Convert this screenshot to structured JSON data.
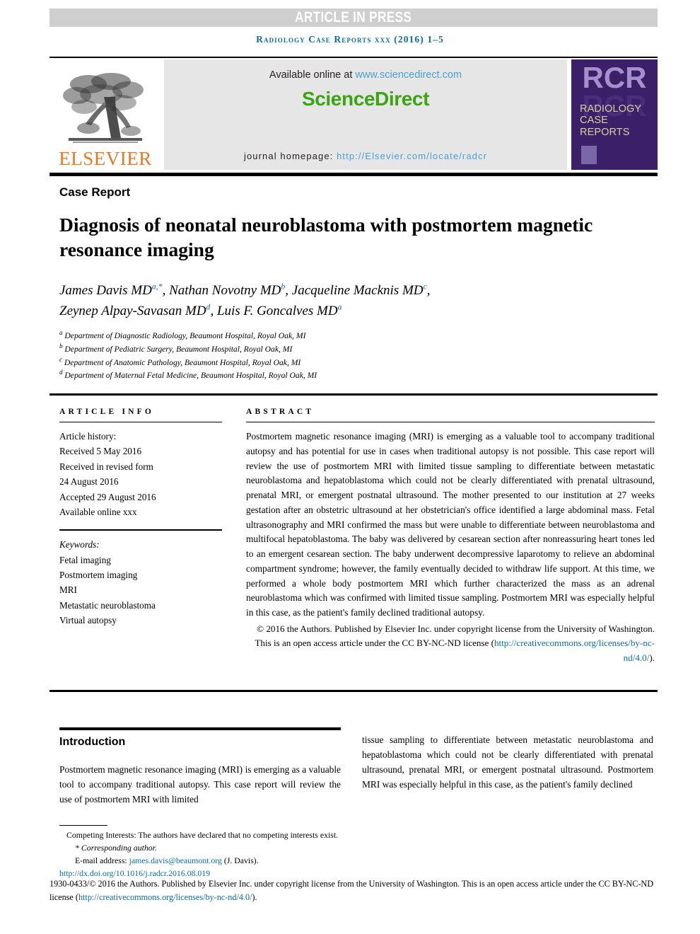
{
  "banner": {
    "label": "ARTICLE IN PRESS"
  },
  "journal_citation": {
    "text": "Radiology Case Reports xxx (2016) 1–5"
  },
  "masthead": {
    "publisher_logo_name": "elsevier-tree-logo",
    "publisher_wordmark": "ELSEVIER",
    "available_prefix": "Available online at ",
    "available_link": "www.sciencedirect.com",
    "sciencedirect_logo": "ScienceDirect",
    "homepage_prefix": "journal homepage: ",
    "homepage_link": "http://Elsevier.com/locate/radcr",
    "cover": {
      "initials": "RCR",
      "line1": "RADIOLOGY",
      "line2": "CASE",
      "line3": "REPORTS"
    }
  },
  "article": {
    "type": "Case Report",
    "title": "Diagnosis of neonatal neuroblastoma with postmortem magnetic resonance imaging",
    "authors": [
      {
        "name": "James Davis MD",
        "marks": "a,*"
      },
      {
        "name": "Nathan Novotny MD",
        "marks": "b"
      },
      {
        "name": "Jacqueline Macknis MD",
        "marks": "c"
      },
      {
        "name": "Zeynep Alpay-Savasan MD",
        "marks": "d"
      },
      {
        "name": "Luis F. Goncalves MD",
        "marks": "a"
      }
    ],
    "affiliations": [
      {
        "mark": "a",
        "text": "Department of Diagnostic Radiology, Beaumont Hospital, Royal Oak, MI"
      },
      {
        "mark": "b",
        "text": "Department of Pediatric Surgery, Beaumont Hospital, Royal Oak, MI"
      },
      {
        "mark": "c",
        "text": "Department of Anatomic Pathology, Beaumont Hospital, Royal Oak, MI"
      },
      {
        "mark": "d",
        "text": "Department of Maternal Fetal Medicine, Beaumont Hospital, Royal Oak, MI"
      }
    ]
  },
  "article_info": {
    "heading": "ARTICLE INFO",
    "history_label": "Article history:",
    "history": [
      "Received 5 May 2016",
      "Received in revised form",
      "24 August 2016",
      "Accepted 29 August 2016",
      "Available online xxx"
    ],
    "keywords_label": "Keywords:",
    "keywords": [
      "Fetal imaging",
      "Postmortem imaging",
      "MRI",
      "Metastatic neuroblastoma",
      "Virtual autopsy"
    ]
  },
  "abstract": {
    "heading": "ABSTRACT",
    "body": "Postmortem magnetic resonance imaging (MRI) is emerging as a valuable tool to accompany traditional autopsy and has potential for use in cases when traditional autopsy is not possible. This case report will review the use of postmortem MRI with limited tissue sampling to differentiate between metastatic neuroblastoma and hepatoblastoma which could not be clearly differentiated with prenatal ultrasound, prenatal MRI, or emergent postnatal ultrasound. The mother presented to our institution at 27 weeks gestation after an obstetric ultrasound at her obstetrician's office identified a large abdominal mass. Fetal ultrasonography and MRI confirmed the mass but were unable to differentiate between neuroblastoma and multifocal hepatoblastoma. The baby was delivered by cesarean section after nonreassuring heart tones led to an emergent cesarean section. The baby underwent decompressive laparotomy to relieve an abdominal compartment syndrome; however, the family eventually decided to withdraw life support. At this time, we performed a whole body postmortem MRI which further characterized the mass as an adrenal neuroblastoma which was confirmed with limited tissue sampling. Postmortem MRI was especially helpful in this case, as the patient's family declined traditional autopsy.",
    "copyright_lead": "© 2016 the Authors. Published by Elsevier Inc. under copyright license from the University of Washington. This is an open access article under the CC BY-NC-ND license (",
    "copyright_link": "http://creativecommons.org/licenses/by-nc-nd/4.0/",
    "copyright_tail": ")."
  },
  "body": {
    "intro_heading": "Introduction",
    "left_paragraph": "Postmortem magnetic resonance imaging (MRI) is emerging as a valuable tool to accompany traditional autopsy. This case report will review the use of postmortem MRI with limited",
    "right_paragraph": "tissue sampling to differentiate between metastatic neuroblastoma and hepatoblastoma which could not be clearly differentiated with prenatal ultrasound, prenatal MRI, or emergent postnatal ultrasound. Postmortem MRI was especially helpful in this case, as the patient's family declined"
  },
  "footnotes": {
    "competing": "Competing Interests: The authors have declared that no competing interests exist.",
    "corresponding": "Corresponding author.",
    "email_label": "E-mail address: ",
    "email": "james.davis@beaumont.org",
    "email_suffix": " (J. Davis).",
    "doi": "http://dx.doi.org/10.1016/j.radcr.2016.08.019",
    "issn_copyright_lead": "1930-0433/© 2016 the Authors. Published by Elsevier Inc. under copyright license from the University of Washington. This is an open access article under the CC BY-NC-ND license (",
    "issn_copyright_link": "http://creativecommons.org/licenses/by-nc-nd/4.0/",
    "issn_copyright_tail": ")."
  },
  "colors": {
    "link_blue": "#0b6ca0",
    "sciencedirect_green": "#3aa411",
    "elsevier_orange": "#e87722",
    "cover_purple": "#3b2069",
    "banner_gray": "#cfcfcf"
  }
}
